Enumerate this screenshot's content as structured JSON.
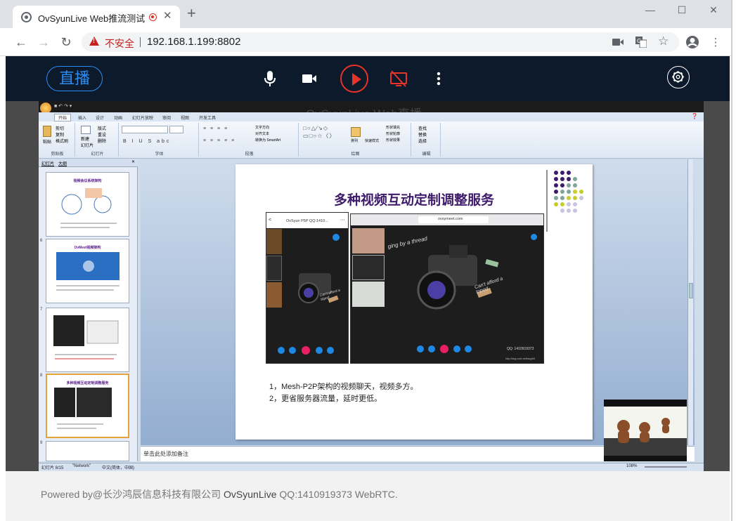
{
  "browser": {
    "tab_title": "OvSyunLive Web推流测试",
    "tab_close": "✕",
    "new_tab": "+",
    "insecure_label": "不安全",
    "url": "192.168.1.199:8802",
    "window_controls": [
      "minimize-icon",
      "maximize-icon",
      "close-icon"
    ]
  },
  "app": {
    "live_button": "直播",
    "controls": [
      "microphone-icon",
      "camera-icon",
      "play-icon",
      "screen-share-off-icon",
      "more-icon"
    ],
    "settings_icon": "gear-icon",
    "accent": "#2d8cf0",
    "play_color": "#e8332a"
  },
  "share": {
    "overlay_title": "OvSyunLive Web直播",
    "ribbon_tabs": [
      "开始",
      "插入",
      "设计",
      "动画",
      "幻灯片放映",
      "审阅",
      "视图",
      "开发工具"
    ],
    "ribbon_groups": [
      "剪贴板",
      "幻灯片",
      "字体",
      "段落",
      "绘图",
      "编辑"
    ],
    "ribbon_cmds": {
      "cut": "剪切",
      "copy": "复制",
      "format": "格式刷",
      "paste": "粘贴",
      "new_slide": "新建\n幻灯片",
      "layout": "版式",
      "reset": "重设",
      "delete": "删除",
      "arrange": "排列",
      "quick_styles": "快速样式",
      "find": "查找",
      "replace": "替换",
      "select": "选择",
      "text_direction": "文字方向",
      "align_text": "对齐文本",
      "smartart": "转换为 SmartArt",
      "shape_fill": "形状填充",
      "shape_outline": "形状轮廓",
      "shape_effects": "形状效果"
    },
    "panel_tabs": [
      "幻灯片",
      "大纲"
    ],
    "thumbnails": [
      {
        "num": "",
        "title": "视频会议系统架构"
      },
      {
        "num": "6",
        "title": "OvMeet视频架构"
      },
      {
        "num": "7",
        "title": ""
      },
      {
        "num": "8",
        "title": "多种视频互动定制调整服务"
      },
      {
        "num": "9",
        "title": ""
      }
    ],
    "slide": {
      "title": "多种视频互动定制调整服务",
      "left_phone_header": "OvSyun P5P QQ:1410...",
      "right_url": "ovsymeet.com",
      "qq_label": "QQ: 1410919373",
      "blog_label": "http://blog.csdn.net/lang4tit",
      "image_text_1": "ging by a thread",
      "image_text_2": "Can't afford a tripod",
      "bullets": [
        "1，Mesh-P2P架构的视频聊天，视频多方。",
        "2，更省服务器流量，延时更低。"
      ]
    },
    "notes_placeholder": "单击此处添加备注",
    "status": {
      "slide_info": "幻灯片 8/15",
      "theme": "\"Network\"",
      "language": "中文(简体，中国)",
      "zoom": "108%"
    }
  },
  "footer": {
    "prefix": "Powered by@长沙鸿辰信息科技有限公司",
    "brand": "OvSyunLive",
    "suffix": "QQ:1410919373 WebRTC."
  }
}
